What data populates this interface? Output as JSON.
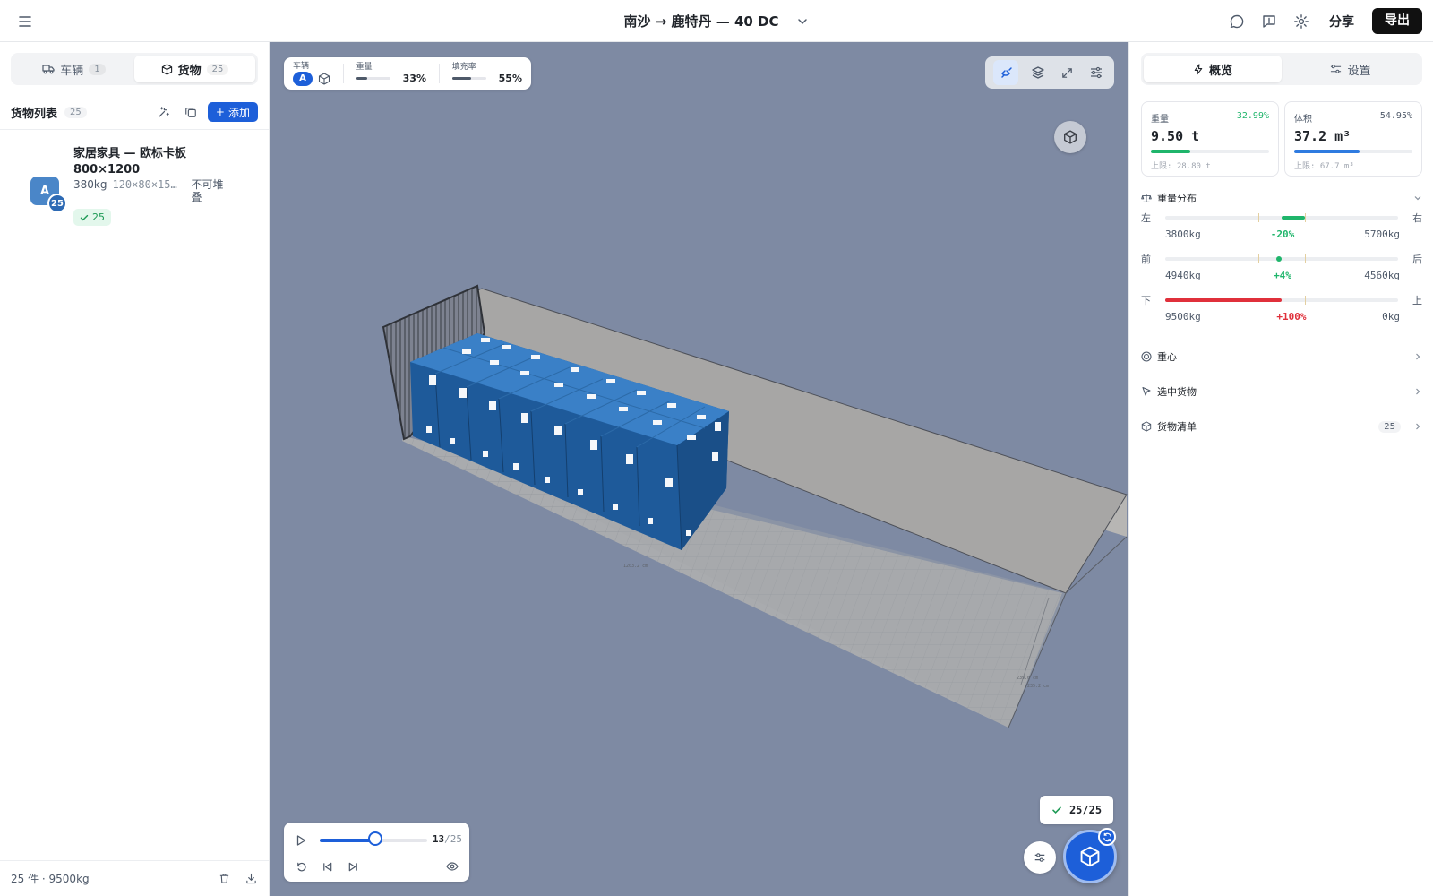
{
  "header": {
    "title": "南沙 → 鹿特丹 — 40 DC",
    "share_label": "分享",
    "export_label": "导出"
  },
  "left_panel": {
    "tabs": [
      {
        "label": "车辆",
        "count": "1",
        "icon": "truck-icon"
      },
      {
        "label": "货物",
        "count": "25",
        "icon": "package-icon"
      }
    ],
    "active_tab": "货物",
    "list_title": "货物列表",
    "list_count": "25",
    "add_label": "添加",
    "items": [
      {
        "avatar": "A",
        "qty_badge": "25",
        "name": "家居家具 — 欧标卡板 800×1200",
        "weight": "380kg",
        "dimensions": "120×80×15…",
        "stacking": "不可堆叠",
        "loaded": "25"
      }
    ],
    "footer": {
      "summary": "25 件 · 9500kg"
    }
  },
  "viewport": {
    "hud": {
      "vehicle_label": "车辆",
      "vehicle_badge": "A",
      "weight_label": "重量",
      "weight_value": "33%",
      "weight_fill": 0.33,
      "fill_label": "填充率",
      "fill_value": "55%",
      "fill_fill": 0.55
    },
    "player": {
      "current": "13",
      "total": "/25",
      "progress": 0.52
    },
    "done_chip": "25/25",
    "accent": "#1d5fd9",
    "container_color": "#2f6fb4"
  },
  "right_panel": {
    "tabs": [
      {
        "label": "概览",
        "icon": "lightning-icon"
      },
      {
        "label": "设置",
        "icon": "sliders-icon"
      }
    ],
    "active_tab": "概览",
    "weight_card": {
      "label": "重量",
      "percent": "32.99%",
      "value": "9.50 t",
      "limit": "上限: 28.80 t",
      "fill": 0.33,
      "color": "#1fb56b"
    },
    "volume_card": {
      "label": "体积",
      "percent": "54.95%",
      "value": "37.2 m³",
      "limit": "上限: 67.7 m³",
      "fill": 0.55,
      "color": "#2f7be0"
    },
    "weight_dist": {
      "title": "重量分布",
      "rows": [
        {
          "left": "左",
          "right": "右",
          "left_val": "3800kg",
          "delta": "-20%",
          "right_val": "5700kg",
          "delta_color": "#1fb56b"
        },
        {
          "left": "前",
          "right": "后",
          "left_val": "4940kg",
          "delta": "+4%",
          "right_val": "4560kg",
          "delta_color": "#1fb56b"
        },
        {
          "left": "下",
          "right": "上",
          "left_val": "9500kg",
          "delta": "+100%",
          "right_val": "0kg",
          "delta_color": "#e0303b"
        }
      ]
    },
    "sections": [
      {
        "label": "重心",
        "icon": "target-icon"
      },
      {
        "label": "选中货物",
        "icon": "cursor-icon"
      },
      {
        "label": "货物清单",
        "icon": "package-icon",
        "count": "25"
      }
    ]
  }
}
